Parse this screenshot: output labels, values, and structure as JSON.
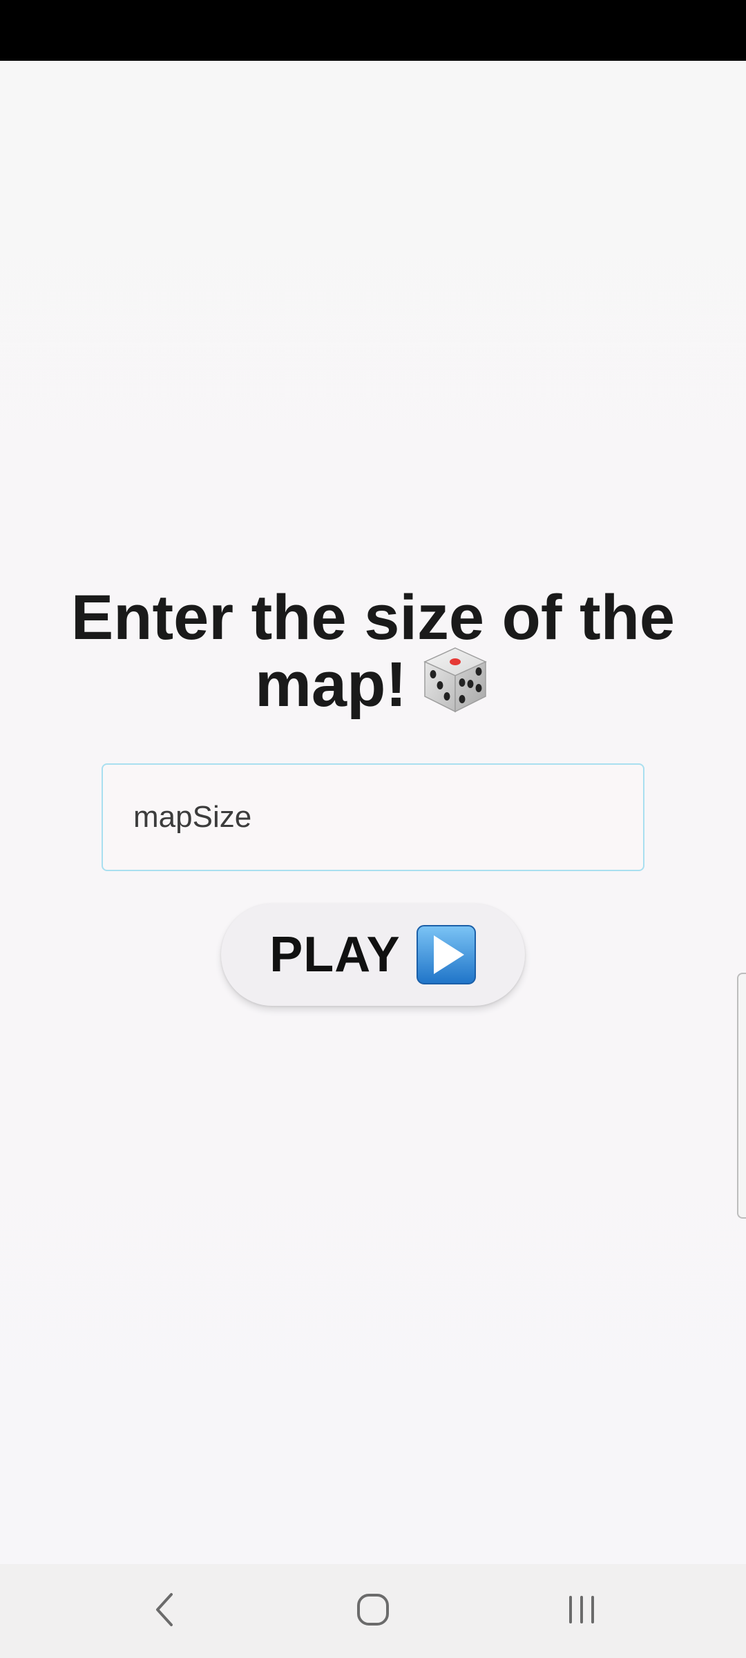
{
  "screen": {
    "title": "Enter the size of the map!",
    "title_icon": "game-die-icon",
    "map_size_input": {
      "placeholder": "mapSize",
      "value": ""
    },
    "play_button": {
      "label": "PLAY",
      "icon": "play-button-icon"
    }
  },
  "navigation_bar": {
    "back_icon": "back-chevron-icon",
    "home_icon": "home-icon",
    "recents_icon": "recent-apps-icon"
  },
  "colors": {
    "input_border": "#a9dff0",
    "play_icon_blue": "#3a8fd8",
    "title_text": "#1a1a1a"
  }
}
